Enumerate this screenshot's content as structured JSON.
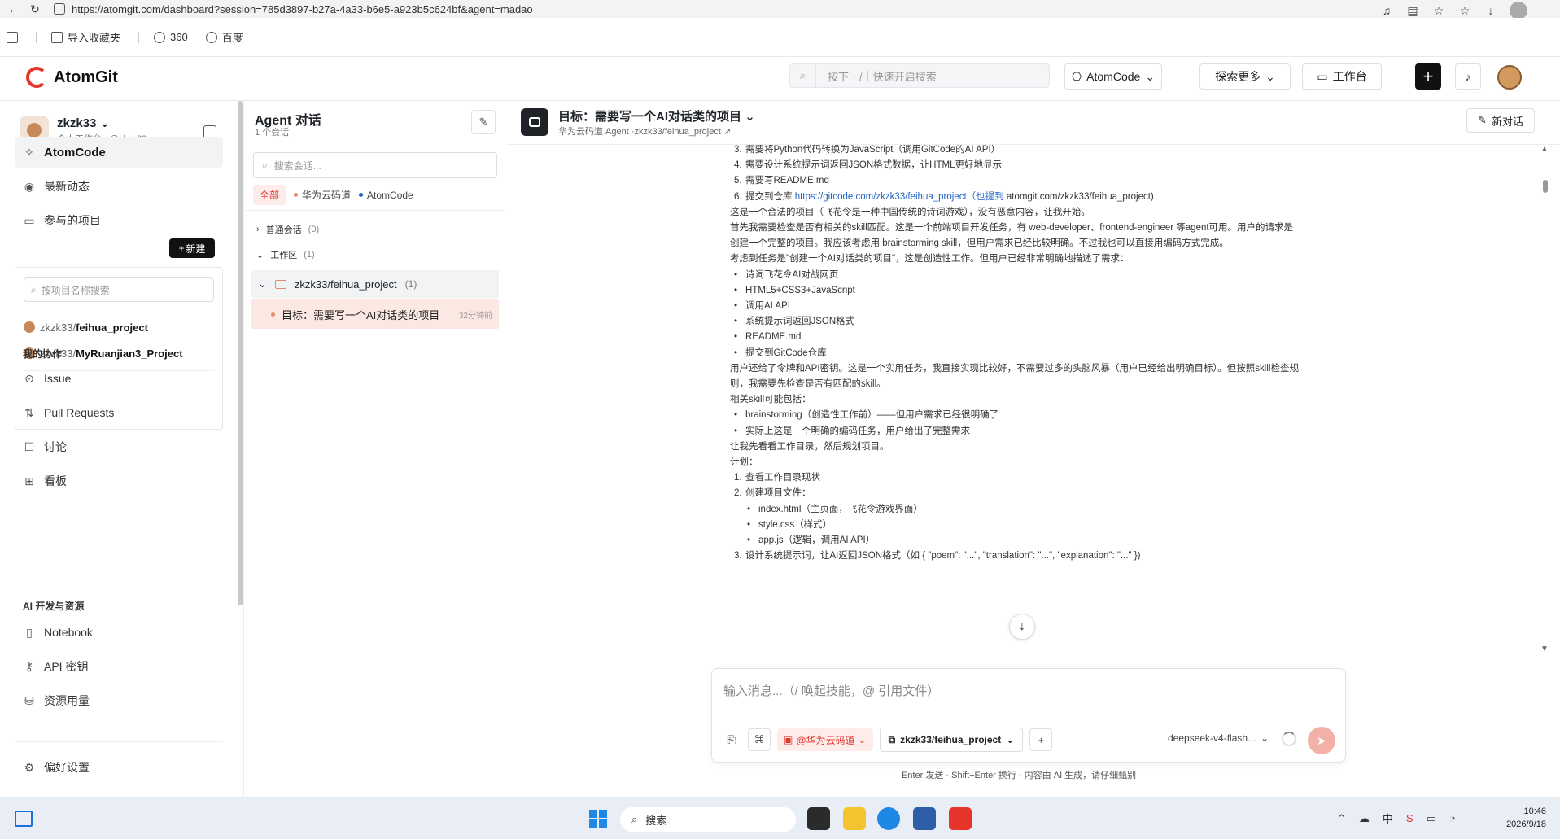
{
  "browser": {
    "url": "https://atomgit.com/dashboard?session=785d3897-b27a-4a33-b6e5-a923b5c624bf&agent=madao",
    "bookmarks": [
      "导入收藏夹",
      "360",
      "百度"
    ]
  },
  "header": {
    "brand": "AtomGit",
    "search_hint_prefix": "按下",
    "search_hint_key": "/",
    "search_hint_suffix": "快速开启搜索",
    "atomcode_label": "AtomCode",
    "explore_label": "探索更多",
    "workbench_label": "工作台"
  },
  "sidebar": {
    "user_name": "zkzk33",
    "user_sub": "个人工作台 · @zkzk33",
    "nav_main": [
      "AtomCode",
      "最新动态",
      "参与的项目"
    ],
    "new_label": "新建",
    "project_search_placeholder": "按项目名称搜索",
    "projects": [
      {
        "owner": "zkzk33/",
        "name": "feihua_project"
      },
      {
        "owner": "zkzk33/",
        "name": "MyRuanjian3_Project"
      }
    ],
    "collab_title": "我的协作",
    "collab_items": [
      "Issue",
      "Pull Requests",
      "讨论",
      "看板"
    ],
    "ai_title": "AI 开发与资源",
    "ai_items": [
      "Notebook",
      "API 密钥",
      "资源用量"
    ],
    "settings": "偏好设置"
  },
  "conversations": {
    "title": "Agent 对话",
    "count_text": "1 个会话",
    "search_placeholder": "搜索会话...",
    "filters": [
      "全部",
      "华为云码道",
      "AtomCode"
    ],
    "group_normal": "普通会话",
    "group_normal_count": "(0)",
    "group_workspace": "工作区",
    "group_workspace_count": "(1)",
    "workspace_name": "zkzk33/feihua_project",
    "workspace_count": "(1)",
    "session_title": "目标：需要写一个AI对话类的项目",
    "session_time": "32分钟前"
  },
  "chat": {
    "title": "目标：需要写一个AI对话类的项目",
    "subtitle": "华为云码道 Agent ·zkzk33/feihua_project",
    "new_chat": "新对话",
    "lines": [
      {
        "t": "n",
        "n": "3.",
        "text": "需要将Python代码转换为JavaScript（调用GitCode的AI API）"
      },
      {
        "t": "n",
        "n": "4.",
        "text": "需要设计系统提示词返回JSON格式数据，让HTML更好地显示"
      },
      {
        "t": "n",
        "n": "5.",
        "text": "需要写README.md"
      },
      {
        "t": "n6",
        "n": "6.",
        "text": "提交到仓库 ",
        "link": "https://gitcode.com/zkzk33/feihua_project（也提到",
        "tail": " atomgit.com/zkzk33/feihua_project)"
      },
      {
        "t": "p",
        "text": "这是一个合法的项目（飞花令是一种中国传统的诗词游戏），没有恶意内容，让我开始。"
      },
      {
        "t": "p",
        "text": "首先我需要检查是否有相关的skill匹配。这是一个前端项目开发任务，有 web-developer、frontend-engineer 等agent可用。用户的请求是"
      },
      {
        "t": "p",
        "text": "创建一个完整的项目。我应该考虑用 brainstorming skill，但用户需求已经比较明确。不过我也可以直接用编码方式完成。"
      },
      {
        "t": "p",
        "text": "考虑到任务是\"创建一个AI对话类的项目\"，这是创造性工作。但用户已经非常明确地描述了需求："
      },
      {
        "t": "b",
        "text": "诗词飞花令AI对战网页"
      },
      {
        "t": "b",
        "text": "HTML5+CSS3+JavaScript"
      },
      {
        "t": "b",
        "text": "调用AI API"
      },
      {
        "t": "b",
        "text": "系统提示词返回JSON格式"
      },
      {
        "t": "b",
        "text": "README.md"
      },
      {
        "t": "b",
        "text": "提交到GitCode仓库"
      },
      {
        "t": "p",
        "text": "用户还给了令牌和API密钥。这是一个实用任务，我直接实现比较好，不需要过多的头脑风暴（用户已经给出明确目标）。但按照skill检查规"
      },
      {
        "t": "p",
        "text": "则，我需要先检查是否有匹配的skill。"
      },
      {
        "t": "p",
        "text": "相关skill可能包括："
      },
      {
        "t": "b",
        "text": "brainstorming（创造性工作前）——但用户需求已经很明确了"
      },
      {
        "t": "b",
        "text": "实际上这是一个明确的编码任务，用户给出了完整需求"
      },
      {
        "t": "p",
        "text": "让我先看看工作目录，然后规划项目。"
      },
      {
        "t": "p",
        "text": "计划："
      },
      {
        "t": "n",
        "n": "1.",
        "text": "查看工作目录现状"
      },
      {
        "t": "n",
        "n": "2.",
        "text": "创建项目文件："
      },
      {
        "t": "b2",
        "text": "index.html（主页面，飞花令游戏界面）"
      },
      {
        "t": "b2",
        "text": "style.css（样式）"
      },
      {
        "t": "b2",
        "text": "app.js（逻辑，调用AI API）"
      },
      {
        "t": "n",
        "n": "3.",
        "text": "设计系统提示词，让AI返回JSON格式（如 { \"poem\": \"...\", \"translation\": \"...\", \"explanation\": \"...\" })"
      }
    ]
  },
  "composer": {
    "placeholder": "输入消息...（/ 唤起技能，@ 引用文件）",
    "agent_chip": "@华为云码道",
    "repo": "zkzk33/feihua_project",
    "model": "deepseek-v4-flash...",
    "hint": "Enter 发送 · Shift+Enter 换行 · 内容由 AI 生成，请仔细甄别"
  },
  "taskbar": {
    "search": "搜索",
    "time": "10:46",
    "date": "2026/9/18",
    "ime": "中"
  },
  "colors": {
    "accent": "#e5352b",
    "link": "#2264c5",
    "huawei_dot": "#e5352b",
    "atomcode_dot": "#2264c5"
  }
}
